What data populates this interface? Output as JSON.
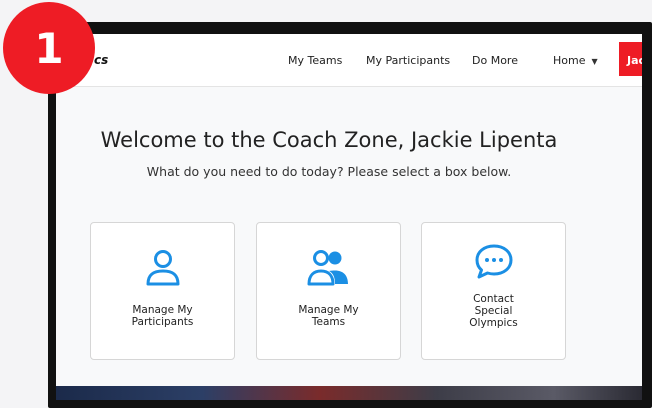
{
  "badge": {
    "number": "1"
  },
  "navbar": {
    "brand_text": "cs",
    "items": [
      {
        "label": "My Teams"
      },
      {
        "label": "My Participants"
      },
      {
        "label": "Do More"
      },
      {
        "label": "Home"
      }
    ],
    "user_label": "Jac"
  },
  "main": {
    "title": "Welcome to the Coach Zone, Jackie Lipenta",
    "subtitle": "What do you need to do today? Please select a box below.",
    "cards": [
      {
        "label": "Manage My\nParticipants",
        "icon": "person-icon"
      },
      {
        "label": "Manage My\nTeams",
        "icon": "group-icon"
      },
      {
        "label": "Contact\nSpecial\nOlympics",
        "icon": "chat-icon"
      }
    ]
  },
  "colors": {
    "accent_red": "#ee1c25",
    "icon_blue": "#1b8fe4",
    "frame": "#111111"
  }
}
